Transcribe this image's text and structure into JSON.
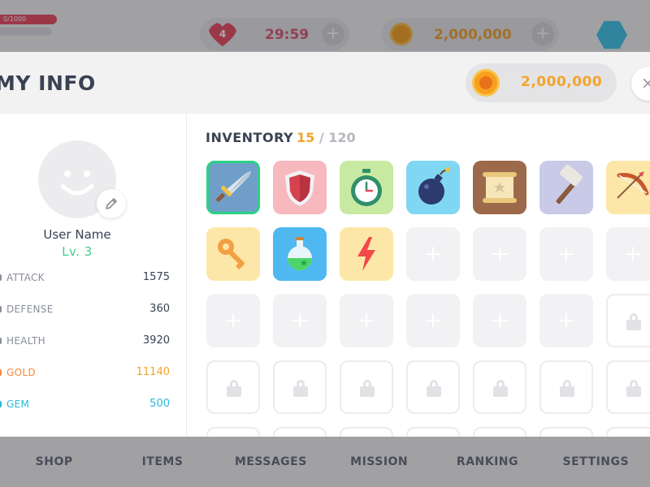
{
  "hud": {
    "hp_text": "0/1000",
    "lives": "4",
    "timer": "29:59",
    "coins": "2,000,000",
    "plus": "+"
  },
  "modal": {
    "title": "MY INFO",
    "coins": "2,000,000",
    "close": "×"
  },
  "profile": {
    "username": "User Name",
    "level": "Lv. 3",
    "stats": [
      {
        "name": "ATTACK",
        "value": "1575"
      },
      {
        "name": "DEFENSE",
        "value": "360"
      },
      {
        "name": "HEALTH",
        "value": "3920"
      },
      {
        "name": "GOLD",
        "value": "11140"
      },
      {
        "name": "GEM",
        "value": "500"
      }
    ]
  },
  "inventory": {
    "title": "INVENTORY",
    "count": "15",
    "separator": "/",
    "max": "120",
    "items": [
      "sword-icon",
      "shield-icon",
      "stopwatch-icon",
      "bomb-icon",
      "scroll-icon",
      "hammer-icon",
      "bow-icon",
      "key-icon",
      "potion-icon",
      "lightning-icon"
    ],
    "plus": "+"
  },
  "nav": {
    "items": [
      "SHOP",
      "ITEMS",
      "MESSAGES",
      "MISSION",
      "RANKING",
      "SETTINGS"
    ]
  },
  "colors": {
    "accent_green": "#2cd185",
    "gold": "#f2a42c",
    "gem": "#2ab8d8",
    "text_dark": "#3a4152"
  }
}
